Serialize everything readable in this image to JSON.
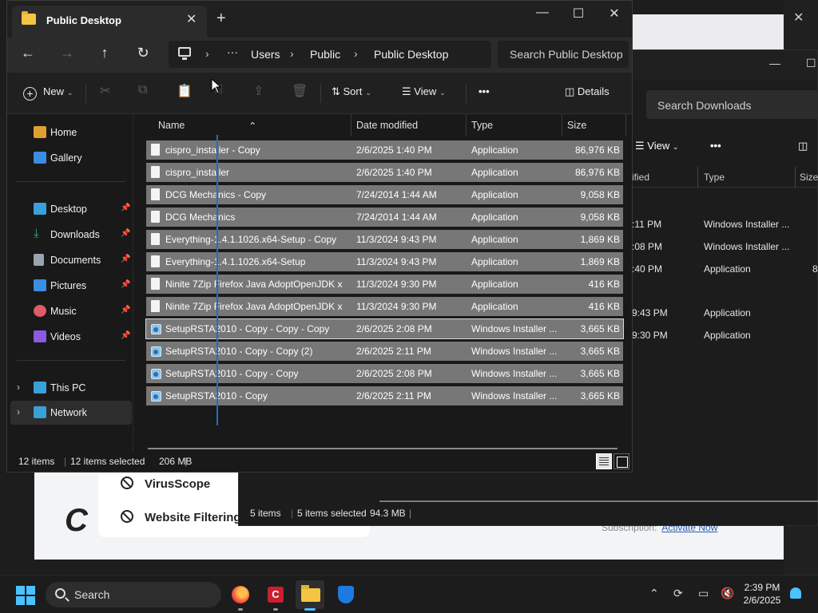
{
  "background_app": {
    "panel_items": [
      "VirusScope",
      "Website Filtering"
    ],
    "logo": "C",
    "subscription_label": "Subscription:",
    "activate_link": "Activate Now"
  },
  "downloads_window": {
    "search_placeholder": "Search Downloads",
    "view_label": "View",
    "columns": [
      "ified",
      "Type",
      "Size"
    ],
    "rows": [
      {
        "date": ":11 PM",
        "type": "Windows Installer ..."
      },
      {
        "date": ":08 PM",
        "type": "Windows Installer ..."
      },
      {
        "date": ":40 PM",
        "type": "Application",
        "size": "8"
      },
      {
        "date": "9:43 PM",
        "type": "Application"
      },
      {
        "date": "9:30 PM",
        "type": "Application"
      }
    ],
    "status": {
      "count": "5 items",
      "selected": "5 items selected",
      "size": "94.3 MB"
    }
  },
  "window": {
    "tab_title": "Public Desktop",
    "breadcrumb": [
      "Users",
      "Public",
      "Public Desktop"
    ],
    "search_placeholder": "Search Public Desktop",
    "toolbar": {
      "new": "New",
      "sort": "Sort",
      "view": "View",
      "more": "•••",
      "details": "Details"
    }
  },
  "sidebar": {
    "items": [
      {
        "label": "Home",
        "color": "#e0a030"
      },
      {
        "label": "Gallery",
        "color": "#3a8de0"
      },
      {
        "label": "Desktop",
        "color": "#3aa0d8"
      },
      {
        "label": "Downloads",
        "color": "#36b36a"
      },
      {
        "label": "Documents",
        "color": "#9aa4b0"
      },
      {
        "label": "Pictures",
        "color": "#3a8de0"
      },
      {
        "label": "Music",
        "color": "#e05a6a"
      },
      {
        "label": "Videos",
        "color": "#8a5ae0"
      },
      {
        "label": "This PC",
        "color": "#3aa0d8"
      },
      {
        "label": "Network",
        "color": "#3aa0d8"
      }
    ]
  },
  "columns": {
    "name": "Name",
    "date": "Date modified",
    "type": "Type",
    "size": "Size"
  },
  "files": [
    {
      "name": "cispro_installer - Copy",
      "date": "2/6/2025 1:40 PM",
      "type": "Application",
      "size": "86,976 KB",
      "icon": "file-icon"
    },
    {
      "name": "cispro_installer",
      "date": "2/6/2025 1:40 PM",
      "type": "Application",
      "size": "86,976 KB",
      "icon": "file-icon"
    },
    {
      "name": "DCG Mechanics - Copy",
      "date": "7/24/2014 1:44 AM",
      "type": "Application",
      "size": "9,058 KB",
      "icon": "file-icon"
    },
    {
      "name": "DCG Mechanics",
      "date": "7/24/2014 1:44 AM",
      "type": "Application",
      "size": "9,058 KB",
      "icon": "file-icon"
    },
    {
      "name": "Everything-1.4.1.1026.x64-Setup - Copy",
      "date": "11/3/2024 9:43 PM",
      "type": "Application",
      "size": "1,869 KB",
      "icon": "file-icon"
    },
    {
      "name": "Everything-1.4.1.1026.x64-Setup",
      "date": "11/3/2024 9:43 PM",
      "type": "Application",
      "size": "1,869 KB",
      "icon": "file-icon"
    },
    {
      "name": "Ninite 7Zip Firefox Java AdoptOpenJDK x...",
      "date": "11/3/2024 9:30 PM",
      "type": "Application",
      "size": "416 KB",
      "icon": "file-icon"
    },
    {
      "name": "Ninite 7Zip Firefox Java AdoptOpenJDK x...",
      "date": "11/3/2024 9:30 PM",
      "type": "Application",
      "size": "416 KB",
      "icon": "file-icon"
    },
    {
      "name": "SetupRSTA2010 - Copy - Copy - Copy",
      "date": "2/6/2025 2:08 PM",
      "type": "Windows Installer ...",
      "size": "3,665 KB",
      "icon": "installer-icon"
    },
    {
      "name": "SetupRSTA2010 - Copy - Copy (2)",
      "date": "2/6/2025 2:11 PM",
      "type": "Windows Installer ...",
      "size": "3,665 KB",
      "icon": "installer-icon"
    },
    {
      "name": "SetupRSTA2010 - Copy - Copy",
      "date": "2/6/2025 2:08 PM",
      "type": "Windows Installer ...",
      "size": "3,665 KB",
      "icon": "installer-icon"
    },
    {
      "name": "SetupRSTA2010 - Copy",
      "date": "2/6/2025 2:11 PM",
      "type": "Windows Installer ...",
      "size": "3,665 KB",
      "icon": "installer-icon"
    }
  ],
  "status": {
    "count": "12 items",
    "selected": "12 items selected",
    "size": "206 MB"
  },
  "taskbar": {
    "search": "Search",
    "time": "2:39 PM",
    "date": "2/6/2025"
  },
  "colors": {
    "selection": "#777777",
    "accent": "#4cc2ff",
    "folder": "#f4c542"
  }
}
